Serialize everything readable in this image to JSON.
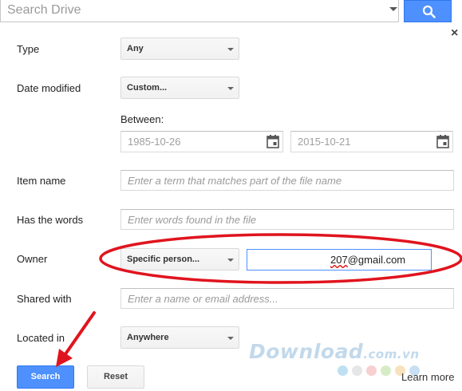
{
  "search": {
    "placeholder": "Search Drive",
    "search_icon": "magnifier-icon"
  },
  "dialog": {
    "close_label": "×",
    "fields": {
      "type": {
        "label": "Type",
        "value": "Any"
      },
      "date_modified": {
        "label": "Date modified",
        "value": "Custom...",
        "between_label": "Between:",
        "start_placeholder": "1985-10-26",
        "end_placeholder": "2015-10-21"
      },
      "item_name": {
        "label": "Item name",
        "placeholder": "Enter a term that matches part of the file name"
      },
      "has_words": {
        "label": "Has the words",
        "placeholder": "Enter words found in the file"
      },
      "owner": {
        "label": "Owner",
        "value": "Specific person...",
        "email_prefix": "207",
        "email_suffix": "@gmail.com"
      },
      "shared_with": {
        "label": "Shared with",
        "placeholder": "Enter a name or email address..."
      },
      "located_in": {
        "label": "Located in",
        "value": "Anywhere"
      }
    },
    "buttons": {
      "search": "Search",
      "reset": "Reset"
    },
    "learn_more": "Learn more"
  },
  "watermark": {
    "main": "Download",
    "suffix": ".com.vn"
  },
  "colors": {
    "primary_blue": "#4d90fe",
    "annotation_red": "#e0141e"
  }
}
